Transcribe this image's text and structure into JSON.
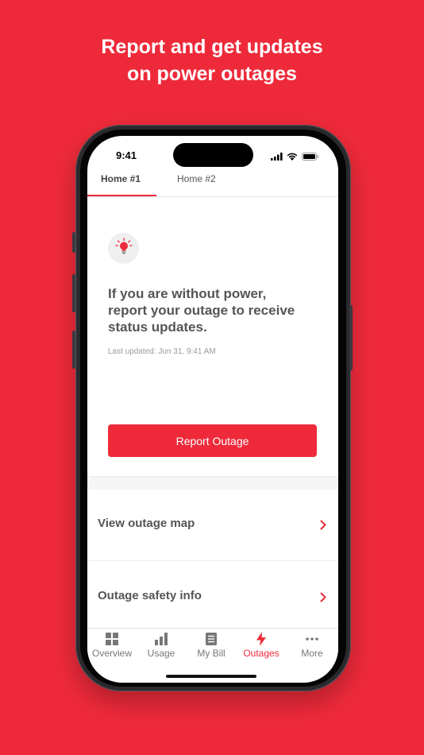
{
  "headline": {
    "line1": "Report and get updates",
    "line2": "on power outages"
  },
  "status_bar": {
    "time": "9:41",
    "icons": [
      "cellular-signal-icon",
      "wifi-icon",
      "battery-icon"
    ]
  },
  "tabs": [
    {
      "label": "Home #1",
      "active": true
    },
    {
      "label": "Home #2",
      "active": false
    }
  ],
  "outage_card": {
    "icon": "lightbulb-icon",
    "message": "If you are without power, report your outage to receive status updates.",
    "last_updated": "Last updated: Jun 31, 9:41 AM",
    "report_button_label": "Report Outage"
  },
  "list_items": [
    {
      "label": "View outage map",
      "icon": "chevron-right-icon"
    },
    {
      "label": "Outage safety info",
      "icon": "chevron-right-icon"
    }
  ],
  "bottom_nav": [
    {
      "label": "Overview",
      "icon": "grid-icon",
      "active": false
    },
    {
      "label": "Usage",
      "icon": "bar-chart-icon",
      "active": false
    },
    {
      "label": "My Bill",
      "icon": "document-icon",
      "active": false
    },
    {
      "label": "Outages",
      "icon": "lightning-icon",
      "active": true
    },
    {
      "label": "More",
      "icon": "more-dots-icon",
      "active": false
    }
  ],
  "colors": {
    "brand_red": "#EE2A3A",
    "text_gray": "#555555",
    "muted_gray": "#999999"
  }
}
